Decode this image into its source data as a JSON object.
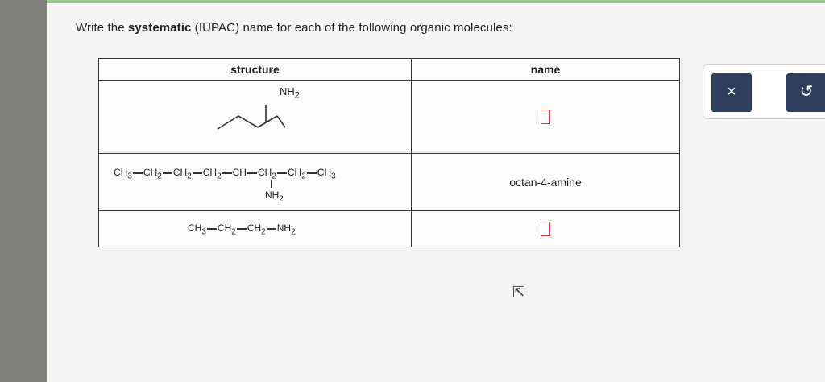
{
  "prompt": {
    "before": "Write the ",
    "bold": "systematic",
    "after": " (IUPAC) name for each of the following organic molecules:"
  },
  "table": {
    "header_structure": "structure",
    "header_name": "name",
    "rows": [
      {
        "structure_label": "NH2",
        "answer": ""
      },
      {
        "structure_parts": [
          "CH3",
          "CH2",
          "CH2",
          "CH2",
          "CH",
          "CH2",
          "CH2",
          "CH3"
        ],
        "substituent": "NH2",
        "answer": "octan-4-amine"
      },
      {
        "structure_parts": [
          "CH3",
          "CH2",
          "CH2",
          "NH2"
        ],
        "answer": ""
      }
    ]
  },
  "buttons": {
    "clear_icon": "×",
    "undo_icon": "↺"
  },
  "colors": {
    "button_bg": "#2c3e5b",
    "answer_box_border": "#d04040",
    "top_accent": "#9dca8e"
  }
}
